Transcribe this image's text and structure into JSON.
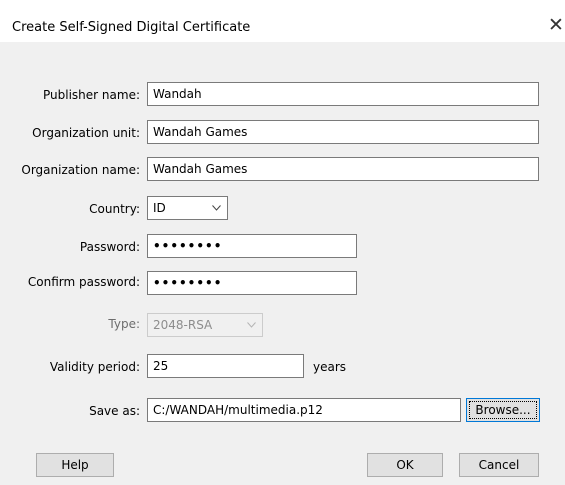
{
  "window": {
    "title": "Create Self-Signed Digital Certificate",
    "close_glyph": "✕"
  },
  "form": {
    "publisher_name": {
      "label": "Publisher name:",
      "value": "Wandah"
    },
    "organization_unit": {
      "label": "Organization unit:",
      "value": "Wandah Games"
    },
    "organization_name": {
      "label": "Organization name:",
      "value": "Wandah Games"
    },
    "country": {
      "label": "Country:",
      "value": "ID"
    },
    "password": {
      "label": "Password:",
      "value": "••••••••"
    },
    "confirm_password": {
      "label": "Confirm password:",
      "value": "••••••••"
    },
    "type": {
      "label": "Type:",
      "value": "2048-RSA",
      "disabled": true
    },
    "validity_period": {
      "label": "Validity period:",
      "value": "25",
      "unit": "years"
    },
    "save_as": {
      "label": "Save as:",
      "value": "C:/WANDAH/multimedia.p12"
    }
  },
  "buttons": {
    "browse": "Browse...",
    "help": "Help",
    "ok": "OK",
    "cancel": "Cancel"
  },
  "icons": {
    "close": "close-icon",
    "dropdown": "chevron-down-icon"
  },
  "colors": {
    "content_bg": "#f0f0f0",
    "focus_border": "#0078d7",
    "disabled_text": "#8d8d8d"
  }
}
